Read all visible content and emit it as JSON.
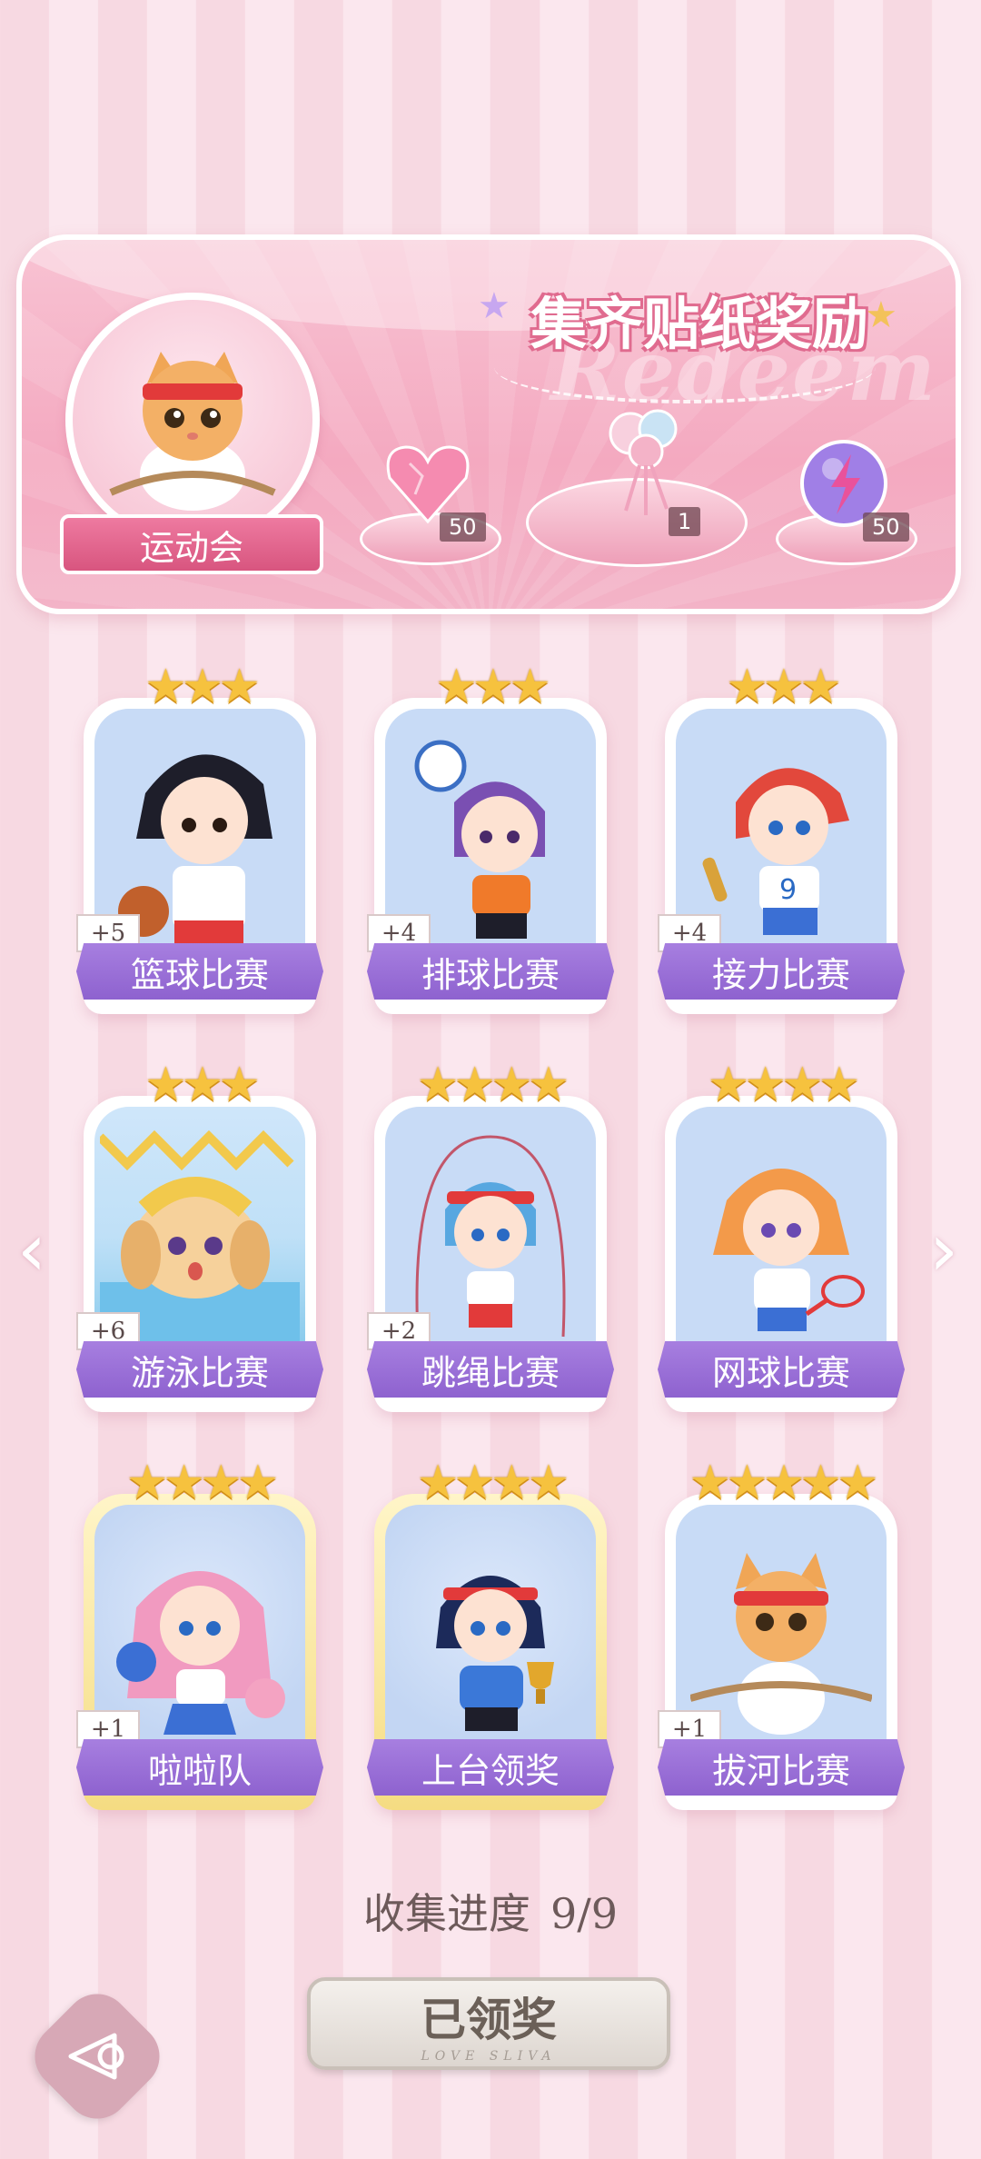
{
  "banner": {
    "title": "集齐贴纸奖励",
    "watermark": "Redeem",
    "event_name": "运动会",
    "rewards": [
      {
        "icon": "pink-heart-gem-icon",
        "quantity": "50"
      },
      {
        "icon": "bouquet-icon",
        "quantity": "1"
      },
      {
        "icon": "purple-lightning-orb-icon",
        "quantity": "50"
      }
    ]
  },
  "stickers": [
    {
      "label": "篮球比赛",
      "bonus": "+5",
      "stars": 3,
      "stars_text": "★★★",
      "theme": "white"
    },
    {
      "label": "排球比赛",
      "bonus": "+4",
      "stars": 3,
      "stars_text": "★★★",
      "theme": "white"
    },
    {
      "label": "接力比赛",
      "bonus": "+4",
      "stars": 3,
      "stars_text": "★★★",
      "theme": "white"
    },
    {
      "label": "游泳比赛",
      "bonus": "+6",
      "stars": 3,
      "stars_text": "★★★",
      "theme": "white"
    },
    {
      "label": "跳绳比赛",
      "bonus": "+2",
      "stars": 4,
      "stars_text": "★★★★",
      "theme": "white"
    },
    {
      "label": "网球比赛",
      "bonus": "",
      "stars": 4,
      "stars_text": "★★★★",
      "theme": "white"
    },
    {
      "label": "啦啦队",
      "bonus": "+1",
      "stars": 4,
      "stars_text": "★★★★",
      "theme": "gold"
    },
    {
      "label": "上台领奖",
      "bonus": "",
      "stars": 4,
      "stars_text": "★★★★",
      "theme": "gold"
    },
    {
      "label": "拔河比赛",
      "bonus": "+1",
      "stars": 5,
      "stars_text": "★★★★★",
      "theme": "white"
    }
  ],
  "progress": {
    "label": "收集进度",
    "value": "9/9"
  },
  "claim_button": {
    "label": "已领奖",
    "sub": "LOVE SLIVA"
  },
  "nav": {
    "left": "‹",
    "right": "›"
  },
  "colors": {
    "accent_pink": "#e06b8f",
    "label_purple": "#8e62cf",
    "star_gold": "#f6c23e"
  }
}
